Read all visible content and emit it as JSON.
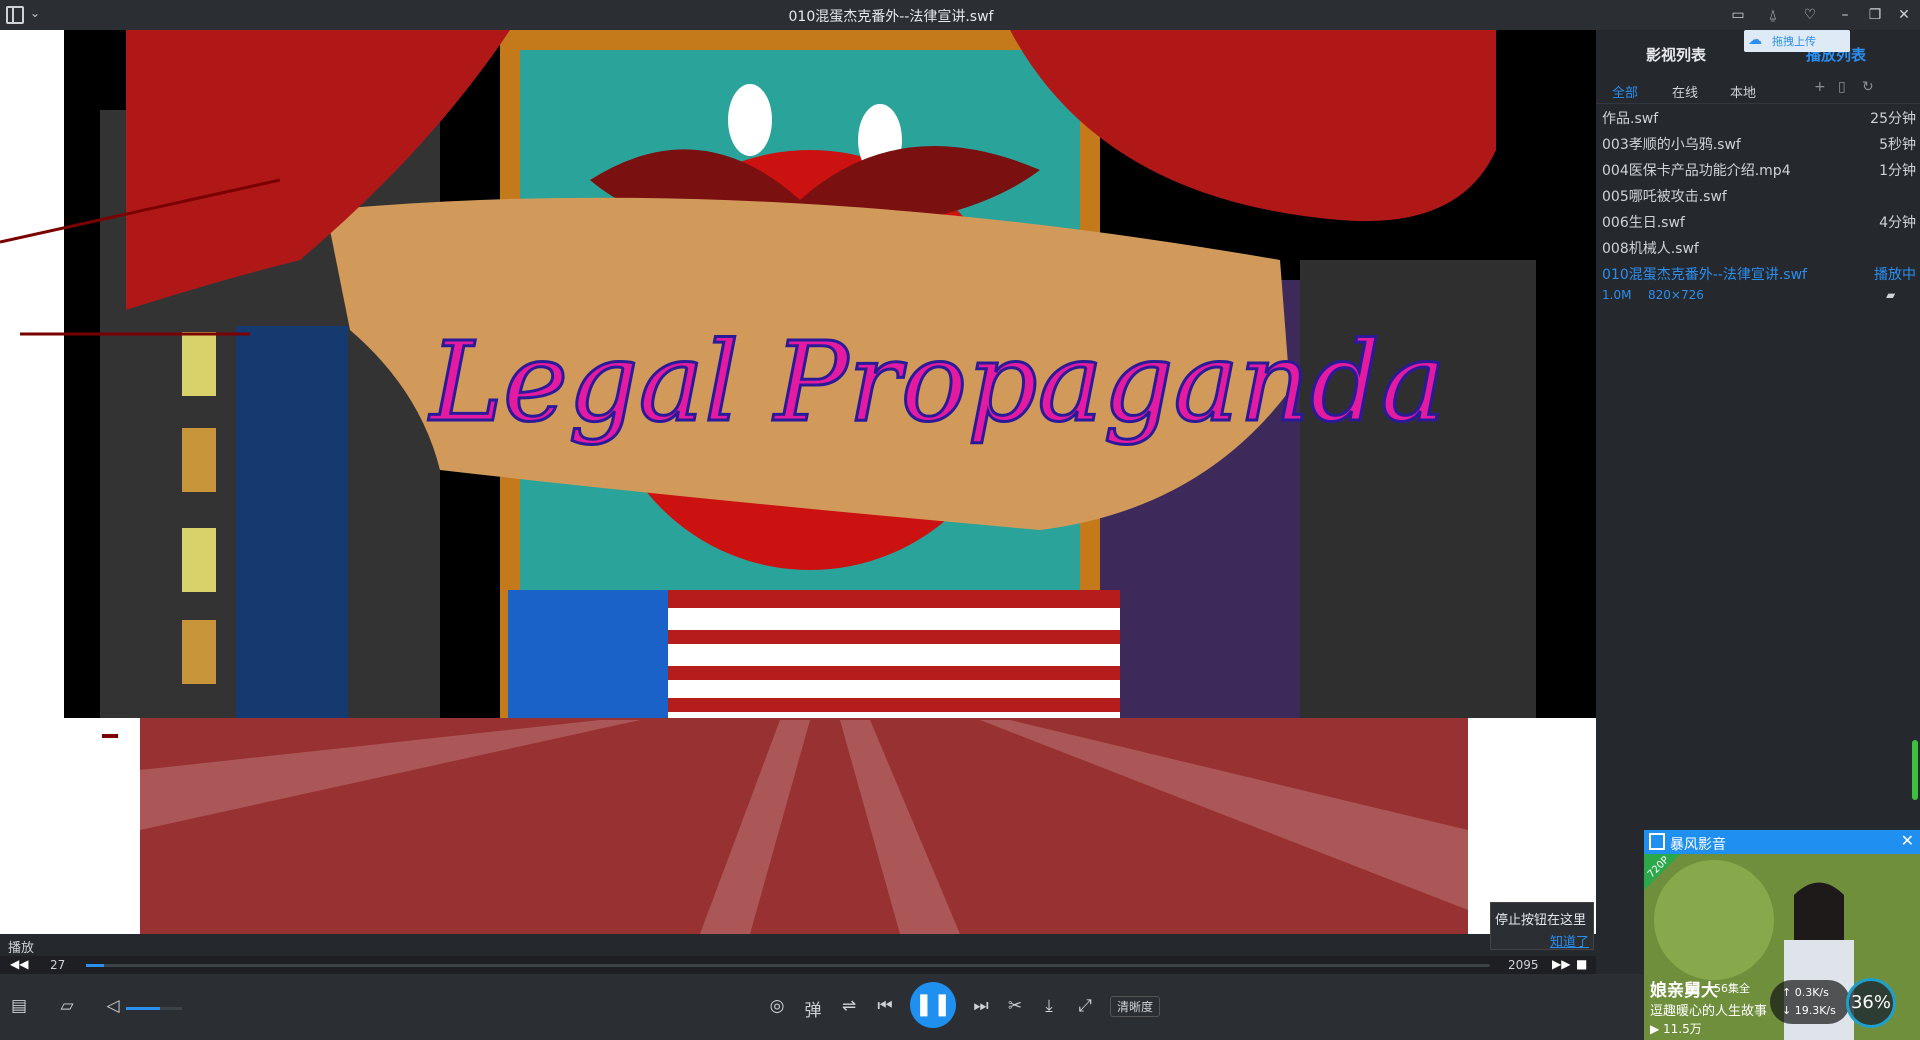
{
  "titlebar": {
    "title": "010混蛋杰克番外--法律宣讲.swf",
    "buttons": [
      "feedback-icon",
      "notification-icon",
      "skin-icon",
      "minimize-icon",
      "restore-icon",
      "close-icon"
    ]
  },
  "video": {
    "banner_text": "Legal Propaganda"
  },
  "status": {
    "label": "播放"
  },
  "tooltip": {
    "text": "停止按钮在这里",
    "link": "知道了"
  },
  "seek": {
    "current": "27",
    "total": "2095",
    "progress": 0.0129
  },
  "controls": {
    "danmaku_label": "弹",
    "quality_label": "清晰度",
    "volume": 0.6,
    "play_state": "playing"
  },
  "sidebar": {
    "tab_video_list": "影视列表",
    "tab_play_list": "播放列表",
    "upload_label": "拖拽上传",
    "subtabs": [
      "全部",
      "在线",
      "本地"
    ],
    "items": [
      {
        "name": "作品.swf",
        "duration": "25分钟"
      },
      {
        "name": "003孝顺的小乌鸦.swf",
        "duration": "5秒钟"
      },
      {
        "name": "004医保卡产品功能介绍.mp4",
        "duration": "1分钟"
      },
      {
        "name": "005哪吒被攻击.swf",
        "duration": ""
      },
      {
        "name": "006生日.swf",
        "duration": "4分钟"
      },
      {
        "name": "008机械人.swf",
        "duration": ""
      },
      {
        "name": "010混蛋杰克番外--法律宣讲.swf",
        "duration": "播放中",
        "active": true
      }
    ],
    "active_meta": {
      "size": "1.0M",
      "resolution": "820×726"
    }
  },
  "ad": {
    "brand": "暴风影音",
    "badge": "720P",
    "show_name": "娘亲舅大",
    "episodes": "56集全",
    "subtitle": "逗趣暖心的人生故事",
    "views": "11.5万",
    "net_up": "0.3K/s",
    "net_down": "19.3K/s",
    "cpu": "36%"
  },
  "colors": {
    "accent": "#1f8ff0",
    "bg": "#25282d",
    "titlebar": "#2b2e33"
  }
}
